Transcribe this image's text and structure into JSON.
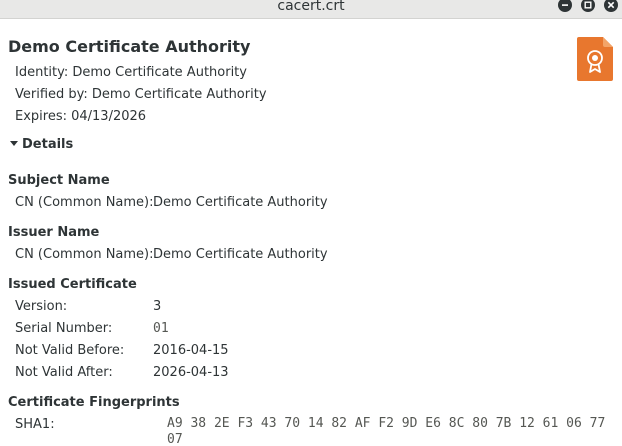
{
  "window": {
    "title": "cacert.crt"
  },
  "certificate": {
    "name": "Demo Certificate Authority",
    "identity_line": "Identity: Demo Certificate Authority",
    "verified_line": "Verified by: Demo Certificate Authority",
    "expires_line": "Expires: 04/13/2026"
  },
  "details": {
    "toggle_label": "Details",
    "subject": {
      "heading": "Subject Name",
      "cn_label": "CN (Common Name):",
      "cn_value": "Demo Certificate Authority"
    },
    "issuer": {
      "heading": "Issuer Name",
      "cn_label": "CN (Common Name):",
      "cn_value": "Demo Certificate Authority"
    },
    "issued": {
      "heading": "Issued Certificate",
      "version_label": "Version:",
      "version_value": "3",
      "serial_label": "Serial Number:",
      "serial_value": "01",
      "not_before_label": "Not Valid Before:",
      "not_before_value": "2016-04-15",
      "not_after_label": "Not Valid After:",
      "not_after_value": "2026-04-13"
    },
    "fingerprints": {
      "heading": "Certificate Fingerprints",
      "sha1_label": "SHA1:",
      "sha1_value": "A9 38 2E F3 43 70 14 82 AF F2 9D E6 8C 80 7B 12 61 06 77 07"
    }
  },
  "icons": {
    "window_buttons": [
      "minimize-icon",
      "maximize-icon",
      "close-icon"
    ],
    "certificate": "certificate-icon"
  },
  "colors": {
    "certificate_icon": "#e8772e",
    "titlebar": "#e8e8e7"
  }
}
